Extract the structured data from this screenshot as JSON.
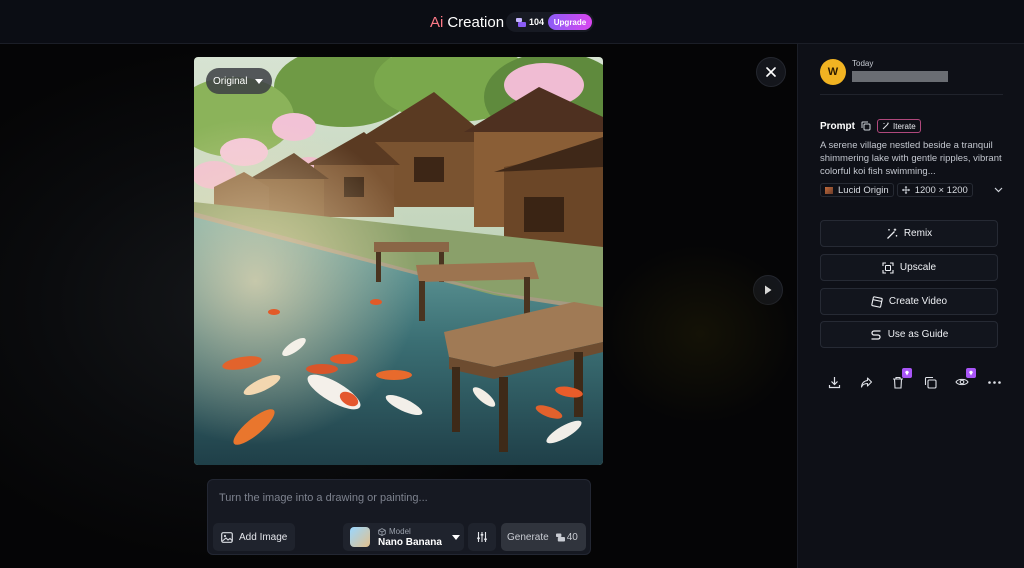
{
  "header": {
    "title_ai": "Ai",
    "title_rest": "Creation",
    "credits": "104",
    "upgrade_label": "Upgrade"
  },
  "viewer": {
    "original_label": "Original",
    "image_description": "Anime-style lakeside village with wooden houses, cherry blossom trees, wooden docks and koi fish swimming in clear water"
  },
  "composer": {
    "placeholder": "Turn the image into a drawing or painting...",
    "add_image_label": "Add Image",
    "model_caption": "Model",
    "model_name": "Nano Banana",
    "generate_label": "Generate",
    "generate_cost": "40"
  },
  "panel": {
    "avatar_initial": "W",
    "date_label": "Today",
    "prompt_heading": "Prompt",
    "iterate_label": "Iterate",
    "prompt_text": "A serene village nestled beside a tranquil shimmering lake with gentle ripples, vibrant colorful koi fish swimming...",
    "model_chip": "Lucid Origin",
    "size_chip": "1200 × 1200",
    "actions": [
      {
        "label": "Remix",
        "icon": "magic-wand-icon"
      },
      {
        "label": "Upscale",
        "icon": "upscale-icon"
      },
      {
        "label": "Create Video",
        "icon": "video-icon"
      },
      {
        "label": "Use as Guide",
        "icon": "guide-icon"
      }
    ],
    "toolbar_icons": [
      "download-icon",
      "share-icon",
      "delete-icon",
      "copy-icon",
      "visibility-icon",
      "more-icon"
    ]
  },
  "colors": {
    "accent_pink": "#ff7a88",
    "upgrade_gradient_start": "#8b5cf6",
    "upgrade_gradient_end": "#d946ef",
    "avatar_bg": "#f1b322",
    "badge_purple": "#a855f7"
  }
}
